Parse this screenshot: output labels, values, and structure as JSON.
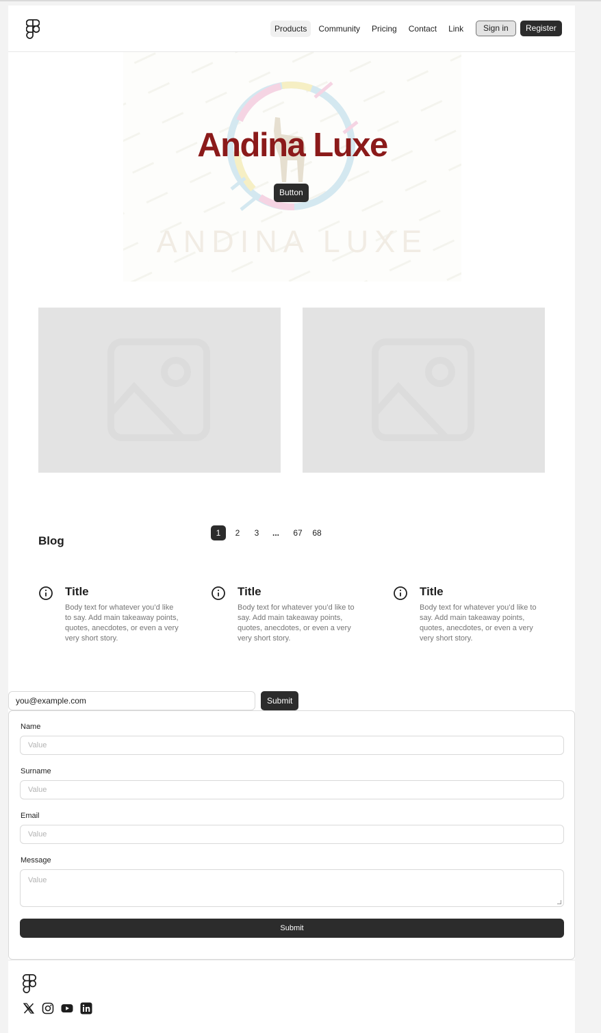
{
  "header": {
    "nav": [
      "Products",
      "Community",
      "Pricing",
      "Contact",
      "Link"
    ],
    "sign_in": "Sign in",
    "register": "Register"
  },
  "hero": {
    "title": "Andina Luxe",
    "button": "Button",
    "logo_wordmark": "ANDINA LUXE"
  },
  "blog": {
    "heading": "Blog",
    "pages": [
      "1",
      "2",
      "3",
      "...",
      "67",
      "68"
    ],
    "cards": [
      {
        "title": "Title",
        "body": "Body text for whatever you’d like to say. Add main takeaway points, quotes, anecdotes, or even a very very short story."
      },
      {
        "title": "Title",
        "body": "Body text for whatever you’d like to say. Add main takeaway points, quotes, anecdotes, or even a very very short story."
      },
      {
        "title": "Title",
        "body": "Body text for whatever you’d like to say. Add main takeaway points, quotes, anecdotes, or even a very very short story."
      }
    ]
  },
  "newsletter": {
    "email_value": "you@example.com",
    "submit": "Submit"
  },
  "form": {
    "name_label": "Name",
    "name_placeholder": "Value",
    "surname_label": "Surname",
    "surname_placeholder": "Value",
    "email_label": "Email",
    "email_placeholder": "Value",
    "message_label": "Message",
    "message_placeholder": "Value",
    "submit": "Submit"
  },
  "footer": {
    "social_icons": [
      "x-icon",
      "instagram-icon",
      "youtube-icon",
      "linkedin-icon"
    ]
  },
  "colors": {
    "brand_red": "#8b1a1a",
    "button_dark": "#2c2c2c"
  }
}
